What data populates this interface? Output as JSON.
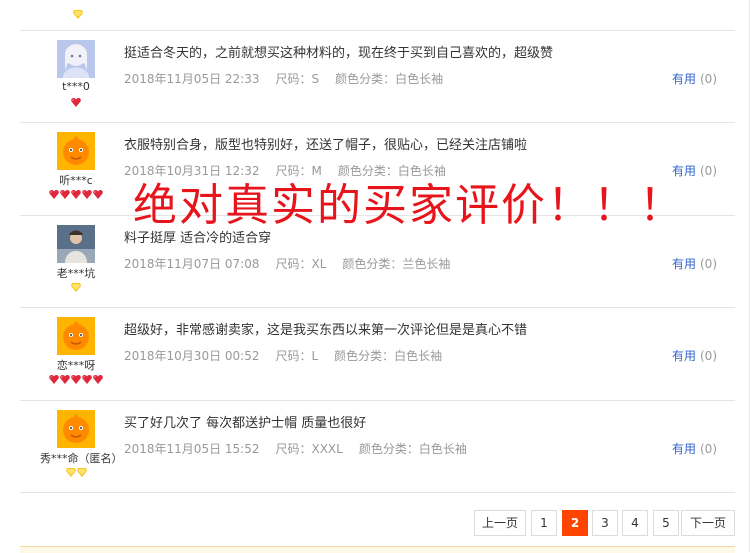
{
  "reviews": [
    {
      "user": "t***0",
      "content": "挺适合冬天的，之前就想买这种材料的，现在终于买到自己喜欢的，超级赞",
      "date": "2018年11月05日 22:33",
      "size": "尺码：S",
      "color": "颜色分类：白色长袖",
      "useful_label": "有用",
      "useful_count": "(0)",
      "avatar": "girl-avatar",
      "badge_type": "red-heart",
      "badge_count": 1
    },
    {
      "user": "听***c",
      "content": "衣服特别合身，版型也特别好，还送了帽子，很贴心，已经关注店铺啦",
      "date": "2018年10月31日 12:32",
      "size": "尺码：M",
      "color": "颜色分类：白色长袖",
      "useful_label": "有用",
      "useful_count": "(0)",
      "avatar": "default-orange-avatar",
      "badge_type": "red-heart",
      "badge_count": 5
    },
    {
      "user": "老***坑",
      "content": "料子挺厚 适合冷的适合穿",
      "date": "2018年11月07日 07:08",
      "size": "尺码：XL",
      "color": "颜色分类：兰色长袖",
      "useful_label": "有用",
      "useful_count": "(0)",
      "avatar": "photo-avatar",
      "badge_type": "yellow-diamond",
      "badge_count": 1
    },
    {
      "user": "恋***呀",
      "content": "超级好，非常感谢卖家，这是我买东西以来第一次评论但是是真心不错",
      "date": "2018年10月30日 00:52",
      "size": "尺码：L",
      "color": "颜色分类：白色长袖",
      "useful_label": "有用",
      "useful_count": "(0)",
      "avatar": "default-orange-avatar",
      "badge_type": "red-heart",
      "badge_count": 5
    },
    {
      "user": "秀***命（匿名）",
      "content": "买了好几次了 每次都送护士帽 质量也很好",
      "date": "2018年11月05日 15:52",
      "size": "尺码：XXXL",
      "color": "颜色分类：白色长袖",
      "useful_label": "有用",
      "useful_count": "(0)",
      "avatar": "default-orange-avatar",
      "badge_type": "yellow-diamond",
      "badge_count": 2
    }
  ],
  "overlay_text": "绝对真实的买家评价！！！",
  "pagination": {
    "prev": "上一页",
    "pages": [
      "1",
      "2",
      "3",
      "4",
      "5"
    ],
    "current": "2",
    "next": "下一页"
  },
  "colors": {
    "accent": "#ff4400",
    "overlay": "#e8141b",
    "link": "#3366cc",
    "meta": "#999999"
  }
}
